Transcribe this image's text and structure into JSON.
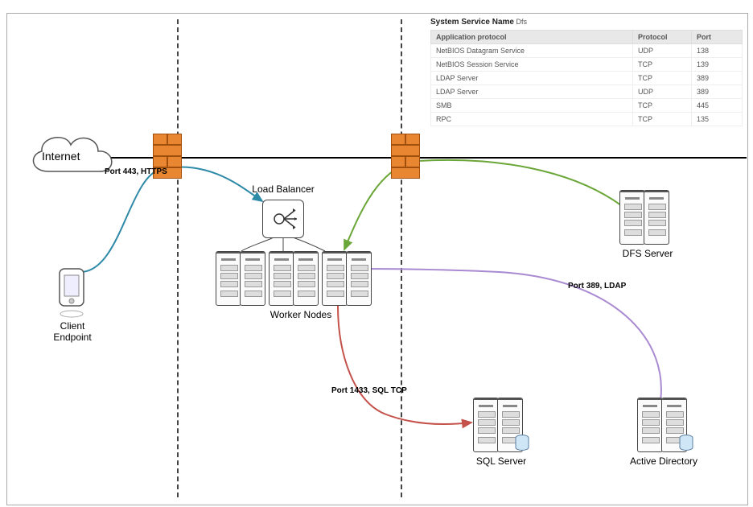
{
  "frame": {
    "segments": 3
  },
  "nodes": {
    "internet": "Internet",
    "client": "Client Endpoint",
    "lb": "Load Balancer",
    "workers": "Worker Nodes",
    "dfs": "DFS Server",
    "sql": "SQL Server",
    "ad": "Active Directory"
  },
  "edge_labels": {
    "https": "Port 443, HTTPS",
    "ldap": "Port 389, LDAP",
    "sql": "Port 1433, SQL TCP"
  },
  "ports_table": {
    "title_prefix": "System Service Name",
    "title_value": "Dfs",
    "headers": [
      "Application protocol",
      "Protocol",
      "Port"
    ],
    "rows": [
      [
        "NetBIOS Datagram Service",
        "UDP",
        "138"
      ],
      [
        "NetBIOS Session Service",
        "TCP",
        "139"
      ],
      [
        "LDAP Server",
        "TCP",
        "389"
      ],
      [
        "LDAP Server",
        "UDP",
        "389"
      ],
      [
        "SMB",
        "TCP",
        "445"
      ],
      [
        "RPC",
        "TCP",
        "135"
      ]
    ]
  },
  "colors": {
    "teal": "#2f8aa8",
    "green": "#6aa638",
    "purple": "#a98ad2",
    "red": "#c4524b"
  }
}
